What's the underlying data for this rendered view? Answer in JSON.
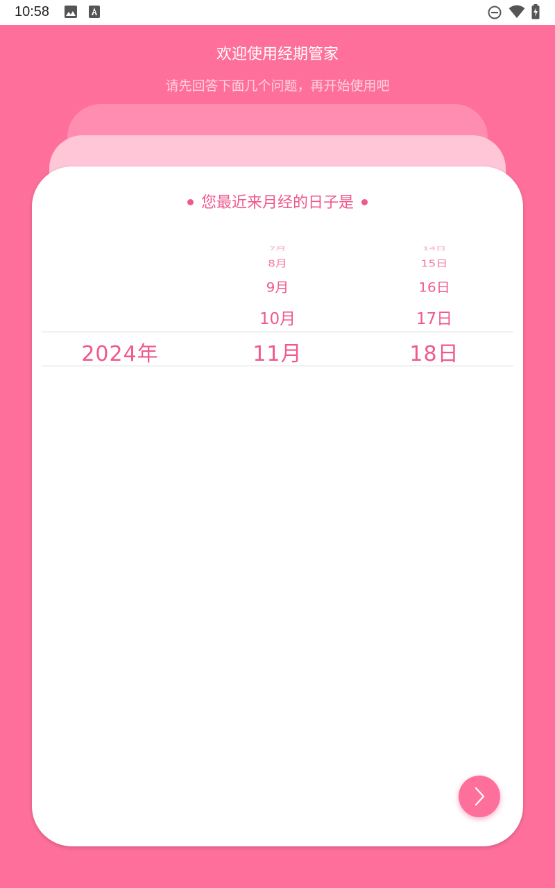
{
  "status_bar": {
    "time": "10:58"
  },
  "header": {
    "title": "欢迎使用经期管家",
    "subtitle": "请先回答下面几个问题，再开始使用吧"
  },
  "question": {
    "text": "您最近来月经的日子是"
  },
  "picker": {
    "year": {
      "selected": "2024年"
    },
    "month": {
      "above": [
        "7月",
        "8月",
        "9月",
        "10月"
      ],
      "selected": "11月"
    },
    "day": {
      "above": [
        "14日",
        "15日",
        "16日",
        "17日"
      ],
      "selected": "18日"
    }
  },
  "colors": {
    "background": "#FF6F9C",
    "accent": "#F0588E",
    "card": "#FFFFFF"
  },
  "icons": {
    "status": [
      "image-icon",
      "text-a-icon",
      "do-not-disturb-icon",
      "wifi-icon",
      "battery-charging-icon"
    ],
    "next": "chevron-right-icon"
  }
}
